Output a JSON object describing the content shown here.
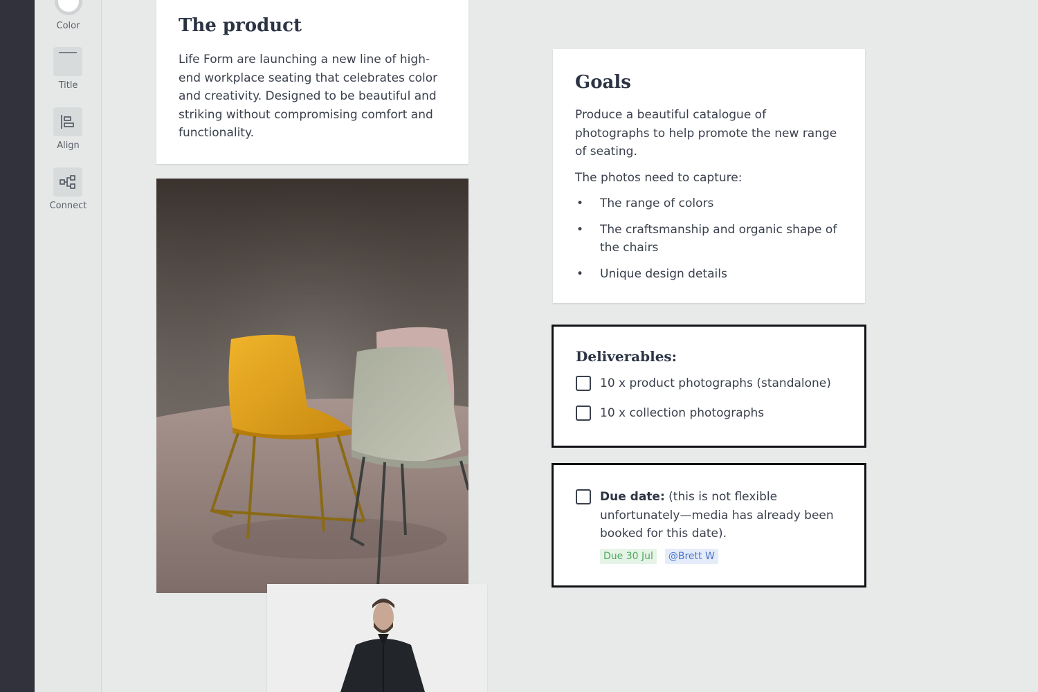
{
  "toolbar": {
    "tools": [
      {
        "label": "Color",
        "icon": "color-circle-icon"
      },
      {
        "label": "Title",
        "icon": "title-icon"
      },
      {
        "label": "Align",
        "icon": "align-left-icon"
      },
      {
        "label": "Connect",
        "icon": "connect-icon"
      }
    ]
  },
  "product": {
    "title": "The product",
    "body": "Life Form are launching a new line of high-end workplace seating that celebrates color and creativity. Designed to be beautiful and striking without compromising comfort and functionality."
  },
  "goals": {
    "title": "Goals",
    "intro": "Produce a beautiful catalogue of photographs to help promote the new range of seating.",
    "capture_label": "The photos need to capture:",
    "bullets": [
      "The range of colors",
      "The craftsmanship and organic shape of the chairs",
      "Unique design details"
    ]
  },
  "deliverables": {
    "title": "Deliverables:",
    "items": [
      {
        "label": "10 x product photographs (standalone)",
        "checked": false
      },
      {
        "label": "10 x collection photographs",
        "checked": false
      }
    ]
  },
  "due": {
    "label": "Due date:",
    "text": " (this is not flexible unfortunately—media has already been booked for this date).",
    "checked": false,
    "tag_due": "Due 30 Jul",
    "tag_mention": "@Brett W"
  },
  "colors": {
    "rail": "#31323c",
    "canvas": "#e8eaea",
    "due_tag_green": "#4aa85a",
    "mention_tag_blue": "#4b72c8"
  }
}
